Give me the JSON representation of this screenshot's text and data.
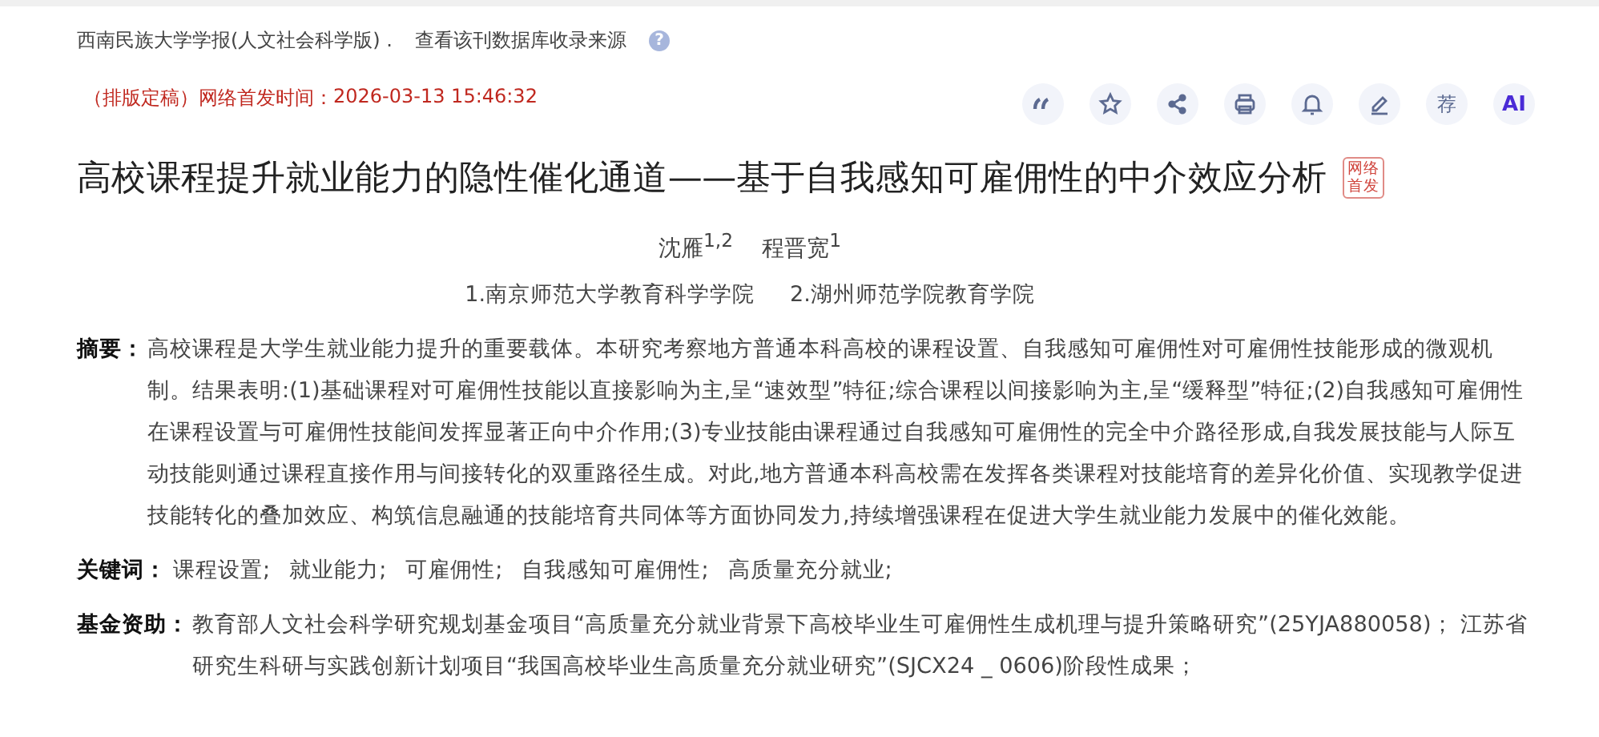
{
  "source": {
    "journal": "西南民族大学学报(人文社会科学版) .",
    "database_link": "查看该刊数据库收录来源",
    "help": "?"
  },
  "publish": {
    "status": "（排版定稿）",
    "label": "网络首发时间：",
    "time": "2026-03-13 15:46:32"
  },
  "toolbar": [
    {
      "kind": "quote"
    },
    {
      "kind": "star"
    },
    {
      "kind": "share"
    },
    {
      "kind": "print"
    },
    {
      "kind": "bell"
    },
    {
      "kind": "pen"
    },
    {
      "kind": "text",
      "text": "荐"
    },
    {
      "kind": "ai",
      "text": "AI"
    }
  ],
  "title": "高校课程提升就业能力的隐性催化通道——基于自我感知可雇佣性的中介效应分析",
  "badge": [
    "网络",
    "首发"
  ],
  "authors": [
    "沈雁$^{1,2}$",
    "程晋宽$^{1}$"
  ],
  "affiliations": [
    "1.南京师范大学教育科学学院",
    "2.湖州师范学院教育学院"
  ],
  "abstract": {
    "label": "摘要：",
    "text": "高校课程是大学生就业能力提升的重要载体。本研究考察地方普通本科高校的课程设置、自我感知可雇佣性对可雇佣性技能形成的微观机制。结果表明:(1)基础课程对可雇佣性技能以直接影响为主,呈“速效型”特征;综合课程以间接影响为主,呈“缓释型”特征;(2)自我感知可雇佣性在课程设置与可雇佣性技能间发挥显著正向中介作用;(3)专业技能由课程通过自我感知可雇佣性的完全中介路径形成,自我发展技能与人际互动技能则通过课程直接作用与间接转化的双重路径生成。对此,地方普通本科高校需在发挥各类课程对技能培育的差异化价值、实现教学促进技能转化的叠加效应、构筑信息融通的技能培育共同体等方面协同发力,持续增强课程在促进大学生就业能力发展中的催化效能。"
  },
  "keywords": {
    "label": "关键词：",
    "items": [
      "课程设置;",
      "就业能力;",
      "可雇佣性;",
      "自我感知可雇佣性;",
      "高质量充分就业;"
    ]
  },
  "funding": {
    "label": "基金资助：",
    "text": "教育部人文社会科学研究规划基金项目“高质量充分就业背景下高校毕业生可雇佣性生成机理与提升策略研究”(25YJA880058)； 江苏省研究生科研与实践创新计划项目“我国高校毕业生高质量充分就业研究”(SJCX24 _ 0606)阶段性成果；"
  }
}
